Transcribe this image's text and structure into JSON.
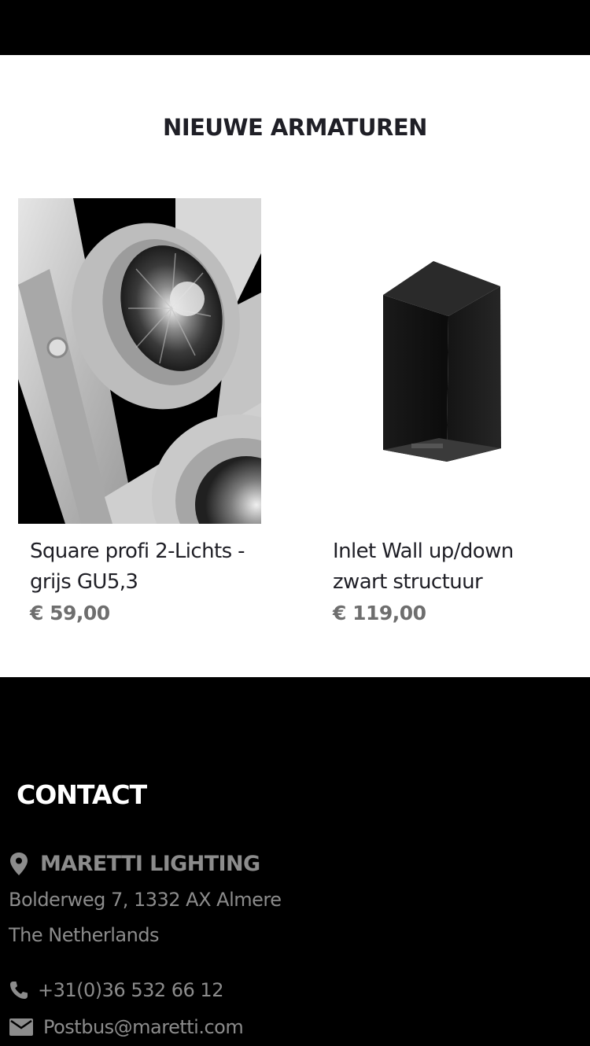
{
  "section": {
    "title": "NIEUWE ARMATUREN"
  },
  "products": [
    {
      "name": "Square profi 2-Lichts - grijs GU5,3",
      "price": "€ 59,00",
      "image": "spotlight-fixture-grey-photo"
    },
    {
      "name": "Inlet Wall up/down zwart structuur",
      "price": "€ 119,00",
      "image": "black-wall-light-photo"
    }
  ],
  "footer": {
    "heading": "CONTACT",
    "company": "MARETTI LIGHTING",
    "address_line1": "Bolderweg 7, 1332 AX Almere",
    "address_line2": "The Netherlands",
    "phone": "+31(0)36 532 66 12",
    "email": "Postbus@maretti.com",
    "icons": {
      "location": "map-pin-icon",
      "phone": "phone-icon",
      "email": "mail-icon"
    }
  },
  "colors": {
    "header_bg": "#000000",
    "footer_bg": "#000000",
    "title_text": "#1f1f26",
    "price_text": "#6e6e6e",
    "footer_text": "#8c8c8c"
  }
}
